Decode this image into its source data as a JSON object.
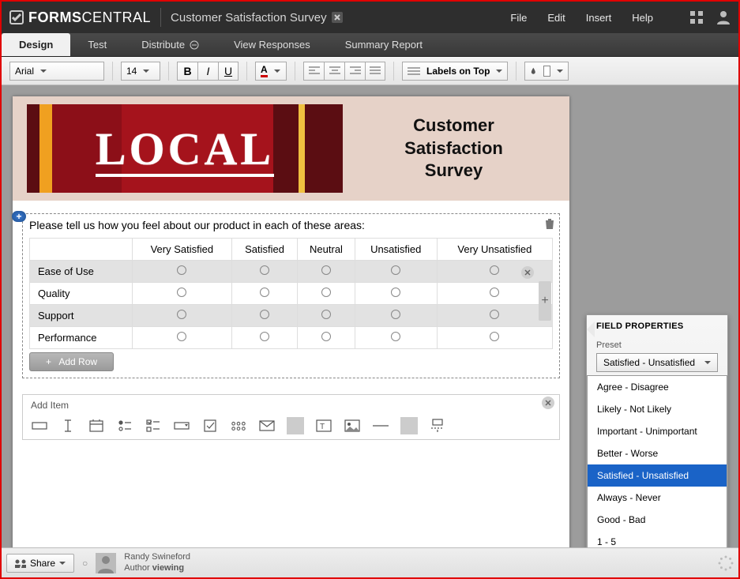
{
  "app": {
    "brand_a": "FORMS",
    "brand_b": "CENTRAL",
    "doc_title": "Customer Satisfaction Survey"
  },
  "menus": {
    "file": "File",
    "edit": "Edit",
    "insert": "Insert",
    "help": "Help"
  },
  "tabs": {
    "design": "Design",
    "test": "Test",
    "distribute": "Distribute",
    "view_responses": "View Responses",
    "summary": "Summary Report"
  },
  "toolbar": {
    "font": "Arial",
    "size": "14",
    "labels_on_top": "Labels on Top"
  },
  "header": {
    "banner_text": "LOCAL",
    "title_l1": "Customer",
    "title_l2": "Satisfaction",
    "title_l3": "Survey"
  },
  "field": {
    "question": "Please tell us how you feel about our product in each of these areas:",
    "columns": [
      "Very Satisfied",
      "Satisfied",
      "Neutral",
      "Unsatisfied",
      "Very Unsatisfied"
    ],
    "rows": [
      "Ease of Use",
      "Quality",
      "Support",
      "Performance"
    ],
    "add_row": "Add Row"
  },
  "add_item": {
    "title": "Add Item"
  },
  "properties": {
    "heading": "FIELD PROPERTIES",
    "preset_label": "Preset",
    "preset_selected": "Satisfied - Unsatisfied",
    "preset_options": [
      "Agree - Disagree",
      "Likely - Not Likely",
      "Important - Unimportant",
      "Better - Worse",
      "Satisfied - Unsatisfied",
      "Always - Never",
      "Good - Bad",
      "1 - 5"
    ]
  },
  "footer": {
    "share": "Share",
    "author_name": "Randy Swineford",
    "author_role": "Author",
    "author_status": "viewing"
  }
}
